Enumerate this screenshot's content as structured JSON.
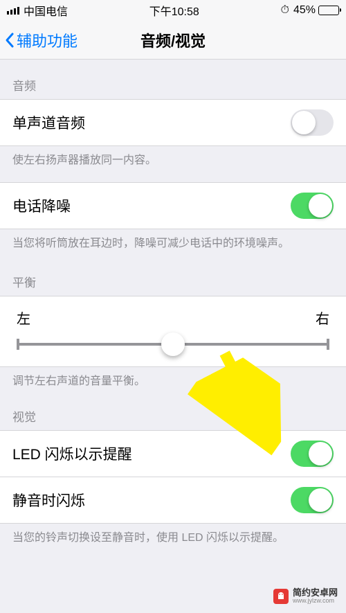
{
  "statusBar": {
    "carrier": "中国电信",
    "time": "下午10:58",
    "battery": "45%"
  },
  "nav": {
    "back": "辅助功能",
    "title": "音频/视觉"
  },
  "sections": {
    "audio": {
      "header": "音频",
      "mono": {
        "label": "单声道音频",
        "on": false
      },
      "monoFooter": "使左右扬声器播放同一内容。",
      "noise": {
        "label": "电话降噪",
        "on": true
      },
      "noiseFooter": "当您将听筒放在耳边时，降噪可减少电话中的环境噪声。"
    },
    "balance": {
      "header": "平衡",
      "left": "左",
      "right": "右",
      "footer": "调节左右声道的音量平衡。"
    },
    "visual": {
      "header": "视觉",
      "led": {
        "label": "LED 闪烁以示提醒",
        "on": true
      },
      "silent": {
        "label": "静音时闪烁",
        "on": true
      },
      "footer": "当您的铃声切换设至静音时，使用 LED 闪烁以示提醒。"
    }
  },
  "watermark": {
    "name": "简约安卓网",
    "url": "www.jylzw.com"
  }
}
